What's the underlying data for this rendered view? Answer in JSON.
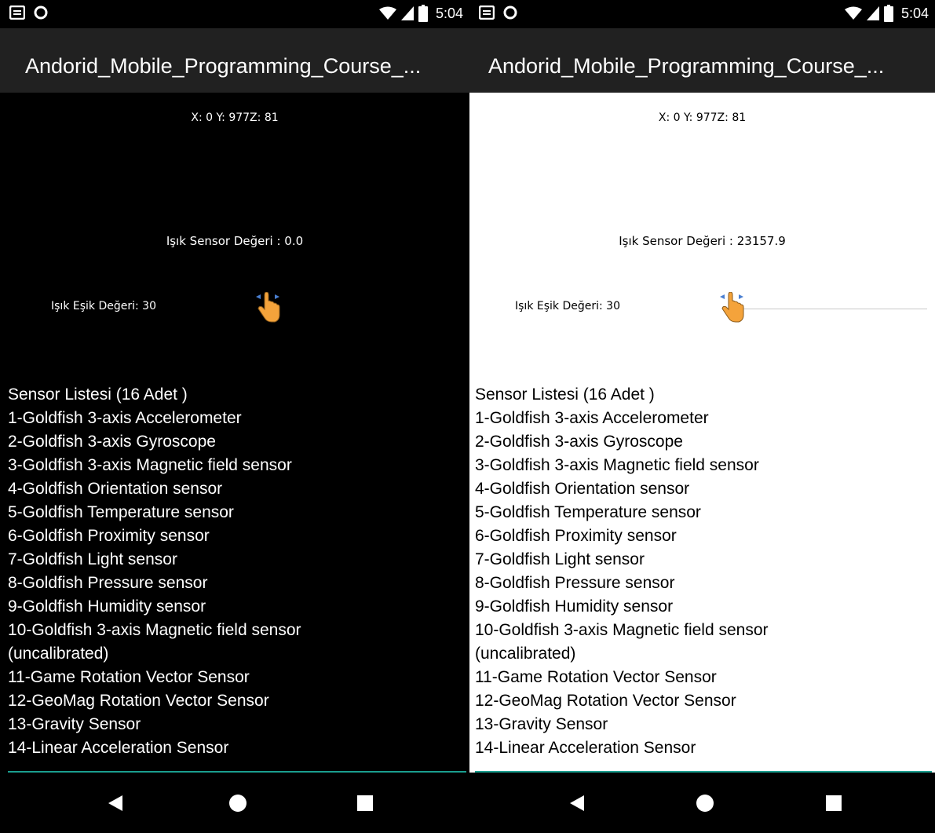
{
  "status_bar": {
    "time": "5:04",
    "icons": [
      "notification-list-icon",
      "notification-circle-icon",
      "wifi-icon",
      "signal-icon",
      "battery-icon"
    ]
  },
  "app_bar": {
    "title": "Andorid_Mobile_Programming_Course_..."
  },
  "screens": [
    {
      "theme": "dark",
      "xyz_readout": "X: 0  Y: 977Z: 81",
      "light_sensor_value": "Işık Sensor Değeri : 0.0",
      "threshold_label": "Işık Eşik Değeri: 30",
      "seekbar_value": 30
    },
    {
      "theme": "light",
      "xyz_readout": "X: 0  Y: 977Z: 81",
      "light_sensor_value": "Işık Sensor Değeri : 23157.9",
      "threshold_label": "Işık Eşik Değeri: 30",
      "seekbar_value": 30
    }
  ],
  "sensor_list": {
    "header": "Sensor Listesi (16 Adet )",
    "items": [
      "1-Goldfish 3-axis Accelerometer",
      "2-Goldfish 3-axis Gyroscope",
      "3-Goldfish 3-axis Magnetic field sensor",
      "4-Goldfish Orientation sensor",
      "5-Goldfish Temperature sensor",
      "6-Goldfish Proximity sensor",
      "7-Goldfish Light sensor",
      "8-Goldfish Pressure sensor",
      "9-Goldfish Humidity sensor",
      "10-Goldfish 3-axis Magnetic field sensor",
      "(uncalibrated)",
      "11-Game Rotation Vector Sensor",
      "12-GeoMag Rotation Vector Sensor",
      "13-Gravity Sensor",
      "14-Linear Acceleration Sensor"
    ]
  },
  "nav_bar": {
    "buttons": [
      "back-icon",
      "home-icon",
      "recents-icon"
    ]
  },
  "colors": {
    "app_bar": "#212121",
    "divider_accent": "#1a9e8f",
    "dark_background": "#000000",
    "light_background": "#ffffff"
  }
}
